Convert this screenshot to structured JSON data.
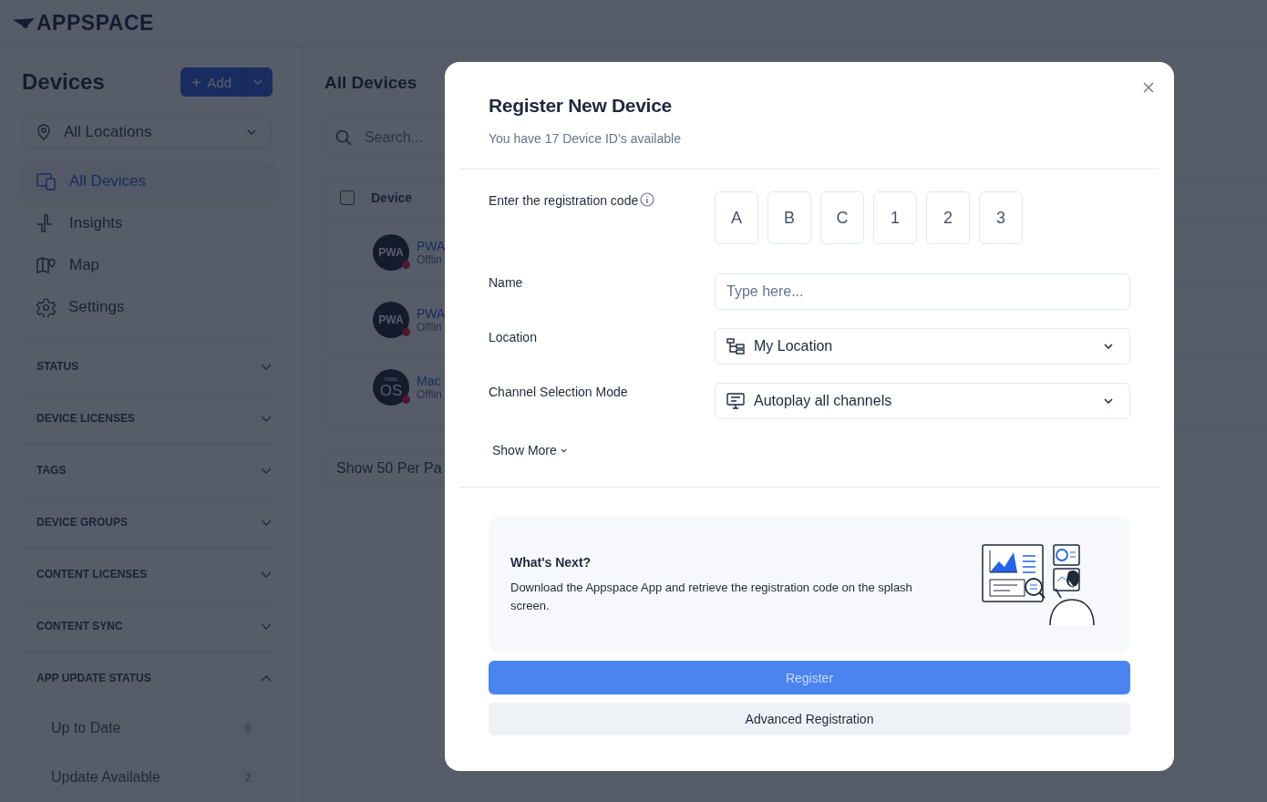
{
  "logo": {
    "text": "APPSPACE"
  },
  "sidebar": {
    "title": "Devices",
    "add_button": "Add",
    "location_filter": "All Locations",
    "nav": [
      {
        "label": "All Devices",
        "kind": "devices",
        "selected": true
      },
      {
        "label": "Insights",
        "kind": "insights",
        "selected": false
      },
      {
        "label": "Map",
        "kind": "map",
        "selected": false
      },
      {
        "label": "Settings",
        "kind": "settings",
        "selected": false
      }
    ],
    "filters": [
      {
        "label": "STATUS",
        "expanded": false
      },
      {
        "label": "DEVICE LICENSES",
        "expanded": false
      },
      {
        "label": "TAGS",
        "expanded": false
      },
      {
        "label": "DEVICE GROUPS",
        "expanded": false
      },
      {
        "label": "CONTENT LICENSES",
        "expanded": false
      },
      {
        "label": "CONTENT SYNC",
        "expanded": false
      },
      {
        "label": "APP UPDATE STATUS",
        "expanded": true,
        "options": [
          {
            "label": "Up to Date",
            "count": "0"
          },
          {
            "label": "Update Available",
            "count": "2"
          }
        ]
      }
    ]
  },
  "main": {
    "title": "All Devices",
    "search": {
      "placeholder": "Search..."
    },
    "table": {
      "select_all_checked": false,
      "columns": [
        "Device"
      ],
      "rows": [
        {
          "avatar": [
            "PWA"
          ],
          "name": "PWA",
          "status": "Offlin"
        },
        {
          "avatar": [
            "PWA"
          ],
          "name": "PWA",
          "status": "Offlin"
        },
        {
          "avatar": [
            "mac",
            "OS"
          ],
          "name": "Mac",
          "status": "Offlin"
        }
      ]
    },
    "page_size": "Show 50 Per Pa"
  },
  "modal": {
    "title": "Register New Device",
    "subtitle": "You have 17 Device ID’s available",
    "code": {
      "label": "Enter the registration code",
      "chars": [
        "A",
        "B",
        "C",
        "1",
        "2",
        "3"
      ]
    },
    "name": {
      "label": "Name",
      "placeholder": "Type here..."
    },
    "location": {
      "label": "Location",
      "value": "My Location"
    },
    "channel_mode": {
      "label": "Channel Selection Mode",
      "value": "Autoplay all channels"
    },
    "show_more": "Show More",
    "whats_next": {
      "title": "What's Next?",
      "text": "Download the Appspace App and retrieve the registration code on the splash screen."
    },
    "register_button": {
      "label": "Register",
      "disabled": true
    },
    "advanced_button": "Advanced Registration"
  }
}
